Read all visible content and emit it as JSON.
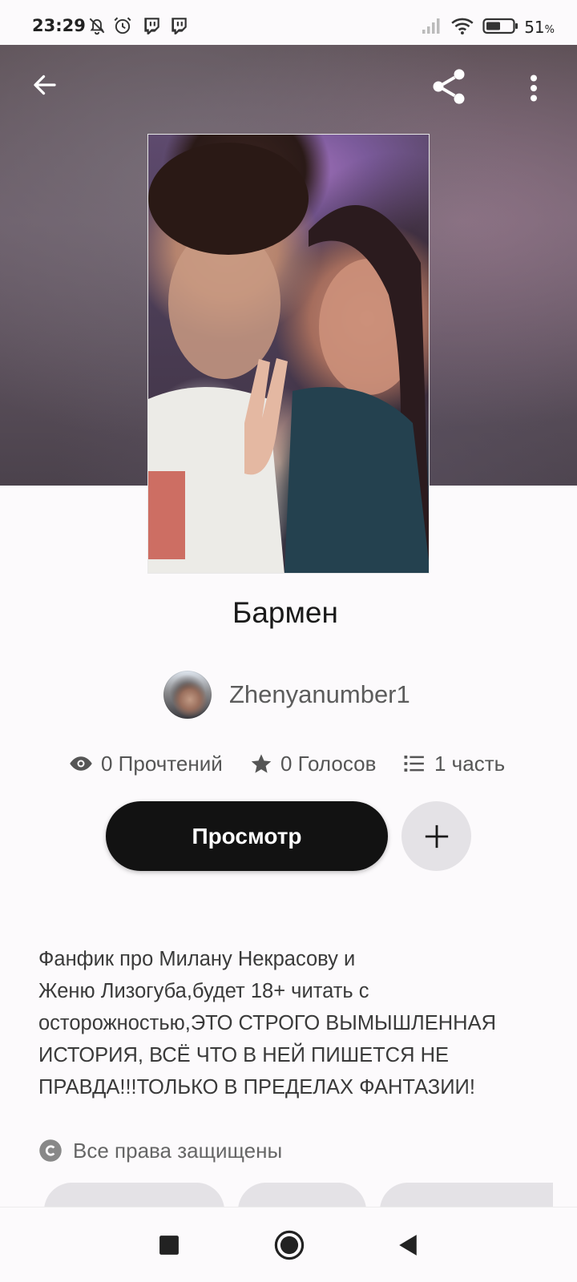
{
  "status_bar": {
    "time": "23:29",
    "battery": "51",
    "battery_unit": "%",
    "icons": [
      "bell-off-icon",
      "alarm-icon",
      "twitch-icon",
      "twitch-icon",
      "signal-icon",
      "wifi-icon",
      "battery-icon"
    ]
  },
  "header": {
    "back_icon": "arrow-left-icon",
    "share_icon": "share-icon",
    "menu_icon": "more-vertical-icon"
  },
  "story": {
    "title": "Бармен",
    "author": "Zhenyanumber1",
    "stats": {
      "reads": "0 Прочтений",
      "votes": "0 Голосов",
      "parts": "1 часть"
    },
    "read_button": "Просмотр",
    "description": "Фанфик про Милану Некрасову и\nЖеню Лизогуба,будет 18+ читать с\nосторожностью,ЭТО СТРОГО ВЫМЫШЛЕННАЯ\nИСТОРИЯ, ВСЁ ЧТО  В НЕЙ ПИШЕТСЯ НЕ\nПРАВДА!!!ТОЛЬКО В ПРЕДЕЛАХ ФАНТАЗИИ!",
    "copyright": "Все права защищены"
  },
  "colors": {
    "primary_button": "#121212",
    "secondary_button": "#e4e2e6",
    "background": "#fcfafc",
    "text_muted": "#5c5c5c"
  }
}
